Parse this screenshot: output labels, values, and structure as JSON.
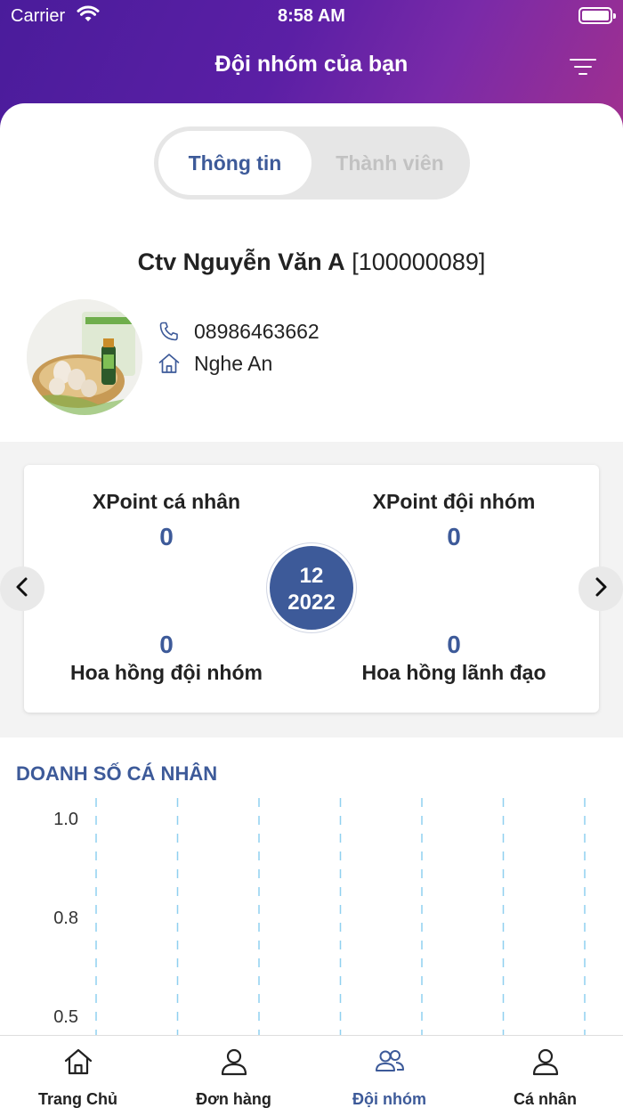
{
  "status_bar": {
    "carrier": "Carrier",
    "time": "8:58 AM"
  },
  "header": {
    "title": "Đội nhóm của bạn"
  },
  "segment": {
    "active_label": "Thông tin",
    "inactive_label": "Thành viên"
  },
  "profile": {
    "name": "Ctv Nguyễn Văn A",
    "id": "[100000089]",
    "phone": "08986463662",
    "address": "Nghe An"
  },
  "stats": {
    "personal_xpoint_label": "XPoint cá nhân",
    "personal_xpoint_value": "0",
    "team_xpoint_label": "XPoint đội nhóm",
    "team_xpoint_value": "0",
    "team_commission_label": "Hoa hồng đội nhóm",
    "team_commission_value": "0",
    "leader_commission_label": "Hoa hồng lãnh đạo",
    "leader_commission_value": "0",
    "period_month": "12",
    "period_year": "2022"
  },
  "chart_data": {
    "type": "line",
    "title": "DOANH SỐ CÁ NHÂN",
    "xlabel": "",
    "ylabel": "",
    "y_tick_labels": [
      "1.0",
      "0.8",
      "0.5"
    ],
    "ylim": [
      0.5,
      1.0
    ],
    "grid": "vertical-dashed",
    "vertical_gridline_count": 7,
    "series": []
  },
  "tabbar": {
    "items": [
      {
        "label": "Trang Chủ",
        "icon": "home-icon"
      },
      {
        "label": "Đơn hàng",
        "icon": "person-icon"
      },
      {
        "label": "Đội nhóm",
        "icon": "group-icon",
        "active": true
      },
      {
        "label": "Cá nhân",
        "icon": "person-icon"
      }
    ]
  },
  "colors": {
    "accent": "#3d5a99",
    "header_gradient_start": "#4a1c9b",
    "header_gradient_end": "#a0308f",
    "chart_grid": "#8fd0f0"
  }
}
